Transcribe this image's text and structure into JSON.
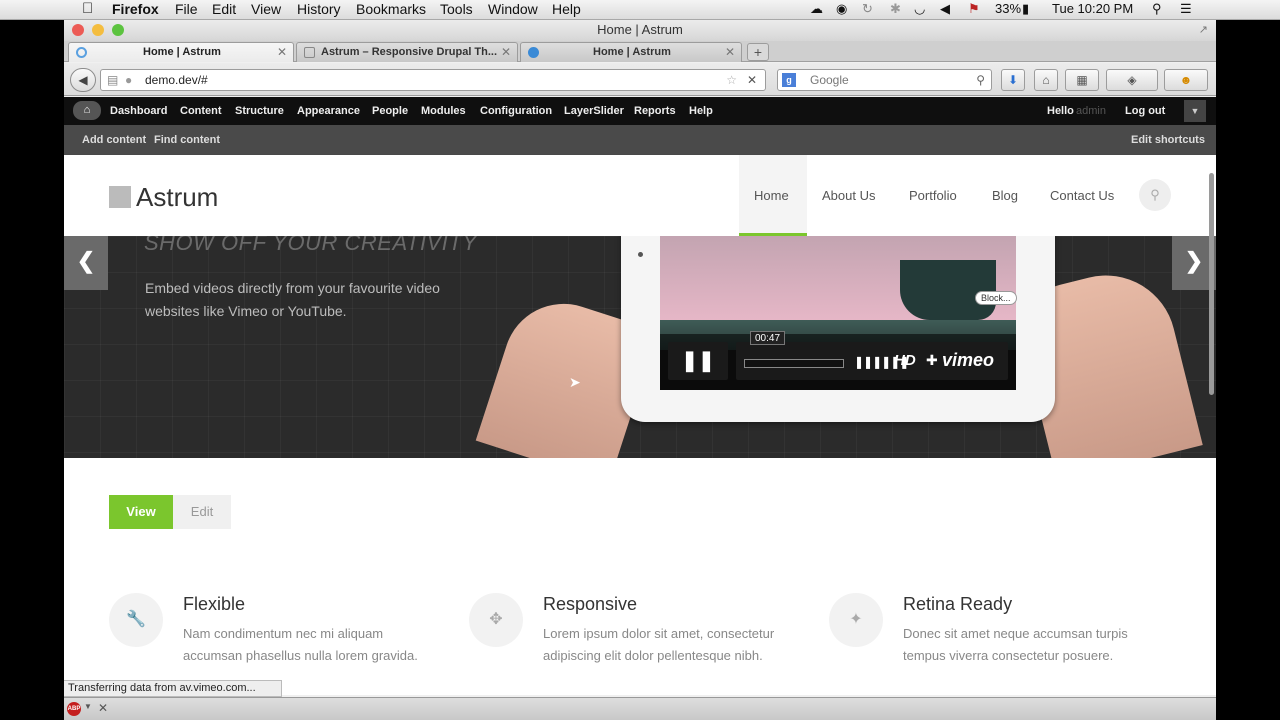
{
  "menubar": {
    "app_name": "Firefox",
    "menus": [
      "File",
      "Edit",
      "View",
      "History",
      "Bookmarks",
      "Tools",
      "Window",
      "Help"
    ],
    "battery": "33%",
    "clock": "Tue 10:20 PM"
  },
  "window": {
    "title": "Home | Astrum",
    "tabs": [
      {
        "label": "Home | Astrum"
      },
      {
        "label": "Astrum – Responsive Drupal Th..."
      },
      {
        "label": "Home | Astrum"
      }
    ],
    "url": "demo.dev/#",
    "search_placeholder": "Google"
  },
  "admin_toolbar": {
    "items": [
      "Dashboard",
      "Content",
      "Structure",
      "Appearance",
      "People",
      "Modules",
      "Configuration",
      "LayerSlider",
      "Reports",
      "Help"
    ],
    "hello": "Hello",
    "username": "admin",
    "logout": "Log out",
    "shortcuts": [
      "Add content",
      "Find content"
    ],
    "edit_shortcuts": "Edit shortcuts"
  },
  "site": {
    "logo": "Astrum",
    "nav": [
      "Home",
      "About Us",
      "Portfolio",
      "Blog",
      "Contact Us"
    ],
    "active_nav": "Home"
  },
  "hero": {
    "title": "SHOW OFF YOUR CREATIVITY",
    "text": "Embed videos directly from your favourite video websites like Vimeo or YouTube.",
    "video": {
      "time": "00:47",
      "hd": "HD",
      "brand": "vimeo",
      "bubble": "Block..."
    }
  },
  "tabs": {
    "view": "View",
    "edit": "Edit"
  },
  "features": [
    {
      "title": "Flexible",
      "desc": "Nam condimentum nec mi aliquam accumsan phasellus nulla lorem gravida.",
      "icon": "wrench-icon"
    },
    {
      "title": "Responsive",
      "desc": "Lorem ipsum dolor sit amet, consectetur adipiscing elit dolor pellentesque nibh.",
      "icon": "move-icon"
    },
    {
      "title": "Retina Ready",
      "desc": "Donec sit amet neque accumsan turpis tempus viverra consectetur posuere.",
      "icon": "magic-wand-icon"
    }
  ],
  "status": "Transferring data from av.vimeo.com...",
  "colors": {
    "accent": "#7bc62d",
    "toolbar": "#0f0f0f",
    "hero_bg": "#2b2b2b"
  }
}
